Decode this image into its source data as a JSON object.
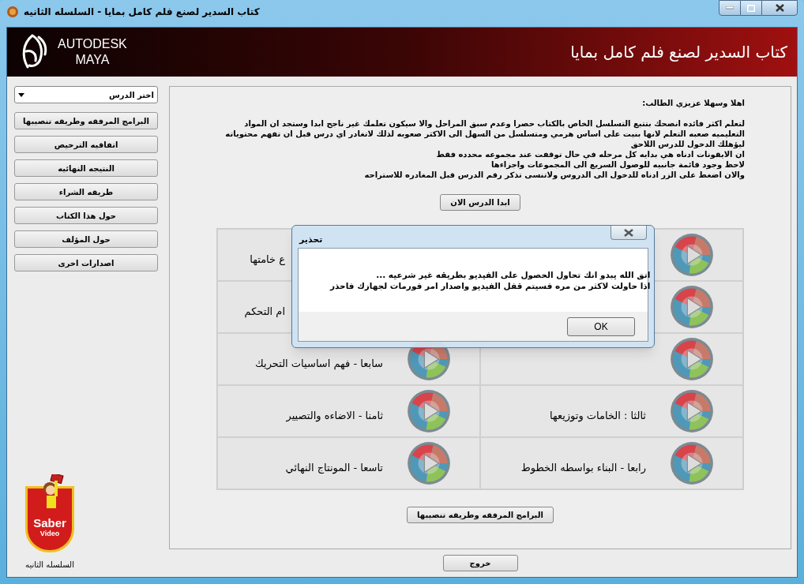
{
  "window": {
    "title": "كتاب السدير لصنع فلم كامل بمايا - السلسله الثانيه"
  },
  "header": {
    "brand_lines": [
      "AUTODESK",
      "MAYA"
    ],
    "title": "كتاب السدير لصنع فلم كامل بمايا"
  },
  "sidebar": {
    "dropdown": {
      "value": "اختر الدرس"
    },
    "buttons": [
      "البرامج المرفقه وطريقه تنصيبها",
      "اتفاقيه الترخيص",
      "النتيجه النهائيه",
      "طريقه الشراء",
      "حول هذا الكتاب",
      "حول المؤلف",
      "اصدارات اخرى"
    ],
    "logo": {
      "texts": [
        "Saber",
        "Video"
      ],
      "caption": "السلسله الثانيه"
    }
  },
  "intro": {
    "greeting": "اهلا وسهلا عزيزي الطالب:",
    "paragraphs": [
      "لتعلم اكثر فائده انصحك بتتبع التسلسل الخاص بالكتاب حصرا وعدم سبق المراحل والا سيكون تعلمك غير ناجح ابدا وستجد ان المواد التعليميه صعبه التعلم لانها بنيت على اساس هرمي ومتسلسل من السهل الى الاكثر صعوبه لذلك لاتغادر اي درس قبل ان تفهم محتوياته ليؤهلك الدخول للدرس اللاحق",
      "ان الايقونات ادناه هي بدايه كل مرحله في حال توقفت عند مجموعه محدده فقط",
      "لاحظ وجود قائمة جانبيه للوصول السريع الى المجموعات واجزاءها",
      "والان اضغط على الزر ادناه للدخول الى الدروس ولاتنسى تذكر رقم الدرس قبل المغادره للاستراحه"
    ],
    "start_button": "ابدا الدرس الان"
  },
  "lessons": [
    [
      {
        "kind": "icon"
      },
      {
        "kind": "text",
        "title": "ع خامتها"
      }
    ],
    [
      {
        "kind": "icon"
      },
      {
        "kind": "text",
        "title": "ام التحكم"
      }
    ],
    [
      {
        "kind": "icon"
      },
      {
        "kind": "lesson",
        "title": "سابعا - فهم اساسيات التحريك"
      }
    ],
    [
      {
        "kind": "lesson",
        "title": "ثالثا : الخامات وتوزيعها"
      },
      {
        "kind": "lesson",
        "title": "ثامنا - الاضاءه والتصيير"
      }
    ],
    [
      {
        "kind": "lesson",
        "title": "رابعا - البناء بواسطه الخطوط"
      },
      {
        "kind": "lesson",
        "title": "تاسعا - المونتاج النهائي"
      }
    ]
  ],
  "bottom_button": "البرامج المرفقه وطريقه تنصيبها",
  "exit_button": "خروج",
  "dialog": {
    "title": "تحذير",
    "message_lines": [
      "اتق الله يبدو انك  تحاول الحصول على الفيديو بطريقه غير شرعيه ...",
      "اذا حاولت لاكثر من مره فسيتم قفل الفيديو واصدار امر فورمات لجهازك فاحذر"
    ],
    "button": "OK"
  }
}
